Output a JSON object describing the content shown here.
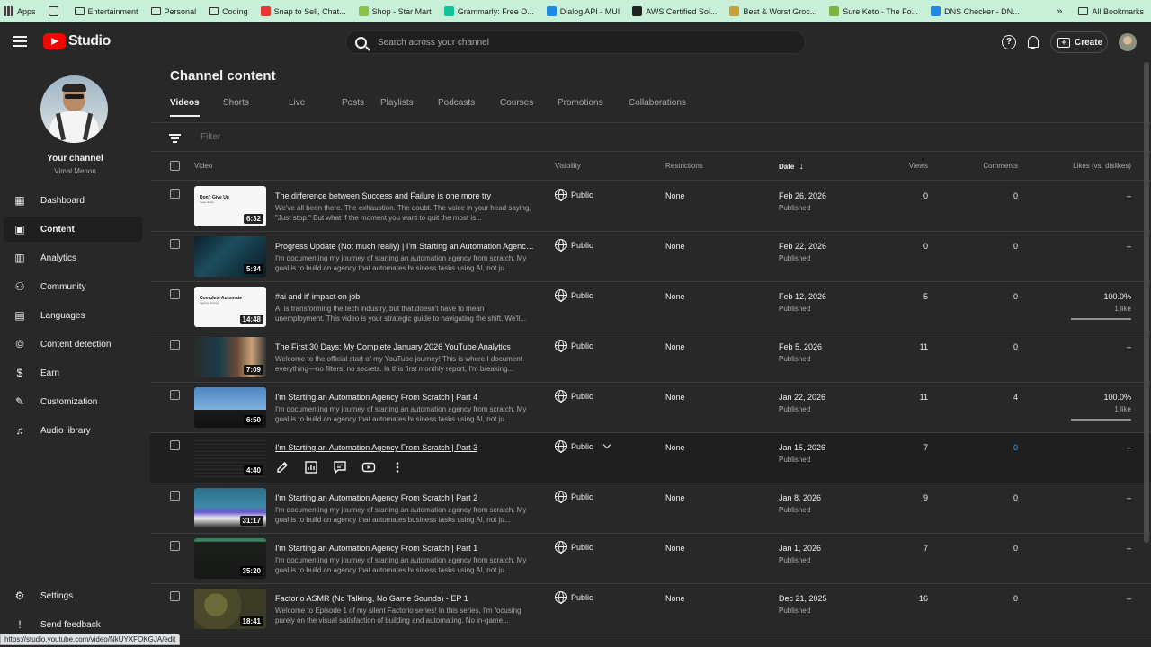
{
  "bookmarks": {
    "apps": "Apps",
    "items": [
      {
        "label": "Entertainment",
        "type": "folder"
      },
      {
        "label": "Personal",
        "type": "folder"
      },
      {
        "label": "Coding",
        "type": "folder"
      },
      {
        "label": "Snap to Sell, Chat...",
        "type": "site",
        "color": "#e53935"
      },
      {
        "label": "Shop - Star Mart",
        "type": "site",
        "color": "#8bc34a"
      },
      {
        "label": "Grammarly: Free O...",
        "type": "site",
        "color": "#15c39a"
      },
      {
        "label": "Dialog API - MUI",
        "type": "site",
        "color": "#1e88e5"
      },
      {
        "label": "AWS Certified Sol...",
        "type": "site",
        "color": "#222222"
      },
      {
        "label": "Best & Worst Groc...",
        "type": "site",
        "color": "#c8a03a"
      },
      {
        "label": "Sure Keto - The Fo...",
        "type": "site",
        "color": "#7cb342"
      },
      {
        "label": "DNS Checker - DN...",
        "type": "site",
        "color": "#1e88e5"
      }
    ],
    "overflow": "»",
    "all_bookmarks": "All Bookmarks"
  },
  "header": {
    "logo_text": "Studio",
    "search_placeholder": "Search across your channel",
    "help_glyph": "?",
    "create_label": "Create",
    "create_glyph": "+"
  },
  "sidebar": {
    "channel_label": "Your channel",
    "channel_name": "Vimal Menon",
    "items": [
      {
        "label": "Dashboard",
        "icon": "dashboard-icon",
        "glyph": "▦"
      },
      {
        "label": "Content",
        "icon": "content-icon",
        "glyph": "▣",
        "active": true
      },
      {
        "label": "Analytics",
        "icon": "analytics-icon",
        "glyph": "▥"
      },
      {
        "label": "Community",
        "icon": "community-icon",
        "glyph": "⚇"
      },
      {
        "label": "Languages",
        "icon": "languages-icon",
        "glyph": "▤"
      },
      {
        "label": "Content detection",
        "icon": "content-detection-icon",
        "glyph": "©"
      },
      {
        "label": "Earn",
        "icon": "earn-icon",
        "glyph": "$"
      },
      {
        "label": "Customization",
        "icon": "customization-icon",
        "glyph": "✎"
      },
      {
        "label": "Audio library",
        "icon": "audio-library-icon",
        "glyph": "♫"
      }
    ],
    "bottom_items": [
      {
        "label": "Settings",
        "icon": "settings-icon",
        "glyph": "⚙"
      },
      {
        "label": "Send feedback",
        "icon": "feedback-icon",
        "glyph": "!"
      }
    ]
  },
  "content": {
    "page_title": "Channel content",
    "tabs": [
      "Videos",
      "Shorts",
      "Live",
      "Posts",
      "Playlists",
      "Podcasts",
      "Courses",
      "Promotions",
      "Collaborations"
    ],
    "active_tab": "Videos",
    "filter_placeholder": "Filter",
    "columns": {
      "video": "Video",
      "visibility": "Visibility",
      "restrictions": "Restrictions",
      "date": "Date",
      "date_sort_glyph": "↓",
      "views": "Views",
      "comments": "Comments",
      "likes": "Likes (vs. dislikes)"
    },
    "rows": [
      {
        "title": "The difference between Success and Failure is one more try",
        "desc": "We've all been there. The exhaustion. The doubt. The voice in your head saying, \"Just stop.\" But what if the moment you want to quit the most is...",
        "duration": "6:32",
        "visibility": "Public",
        "restrictions": "None",
        "date": "Feb 26, 2026",
        "status": "Published",
        "views": "0",
        "comments": "0",
        "likes": "–",
        "likes_sub": "",
        "likes_fraction": 0,
        "thumb": "white",
        "thumb_title": "Don't Give Up",
        "thumb_sub": "Keep Going"
      },
      {
        "title": "Progress Update (Not much really) | I'm Starting an Automation Agency From Scratch",
        "desc": "I'm documenting my journey of starting an automation agency from scratch. My goal is to build an agency that automates business tasks using AI, not ju...",
        "duration": "5:34",
        "visibility": "Public",
        "restrictions": "None",
        "date": "Feb 22, 2026",
        "status": "Published",
        "views": "0",
        "comments": "0",
        "likes": "–",
        "likes_sub": "",
        "likes_fraction": 0,
        "thumb": "robot",
        "thumb_title": "",
        "thumb_sub": ""
      },
      {
        "title": "#ai and it' impact on job",
        "desc": "AI is transforming the tech industry, but that doesn't have to mean unemployment. This video is your strategic guide to navigating the shift. We'll...",
        "duration": "14:48",
        "visibility": "Public",
        "restrictions": "None",
        "date": "Feb 12, 2026",
        "status": "Published",
        "views": "5",
        "comments": "0",
        "likes": "100.0%",
        "likes_sub": "1 like",
        "likes_fraction": 1,
        "thumb": "white",
        "thumb_title": "Complete Automate",
        "thumb_sub": "Agency Journey"
      },
      {
        "title": "The First 30 Days: My Complete January 2026 YouTube Analytics",
        "desc": "Welcome to the official start of my YouTube journey! This is where I document everything—no filters, no secrets. In this first monthly report, I'm breaking...",
        "duration": "7:09",
        "visibility": "Public",
        "restrictions": "None",
        "date": "Feb 5, 2026",
        "status": "Published",
        "views": "11",
        "comments": "0",
        "likes": "–",
        "likes_sub": "",
        "likes_fraction": 0,
        "thumb": "person",
        "thumb_title": "",
        "thumb_sub": ""
      },
      {
        "title": "I'm Starting an Automation Agency From Scratch | Part 4",
        "desc": "I'm documenting my journey of starting an automation agency from scratch. My goal is to build an agency that automates business tasks using AI, not ju...",
        "duration": "6:50",
        "visibility": "Public",
        "restrictions": "None",
        "date": "Jan 22, 2026",
        "status": "Published",
        "views": "11",
        "comments": "4",
        "likes": "100.0%",
        "likes_sub": "1 like",
        "likes_fraction": 1,
        "thumb": "sky",
        "thumb_title": "",
        "thumb_sub": ""
      },
      {
        "title": "I'm Starting an Automation Agency From Scratch | Part 3",
        "desc": "",
        "duration": "4:40",
        "visibility": "Public",
        "restrictions": "None",
        "date": "Jan 15, 2026",
        "status": "Published",
        "views": "7",
        "comments": "0",
        "likes": "–",
        "likes_sub": "",
        "likes_fraction": 0,
        "thumb": "code",
        "thumb_title": "",
        "thumb_sub": "",
        "hover": true
      },
      {
        "title": "I'm Starting an Automation Agency From Scratch | Part 2",
        "desc": "I'm documenting my journey of starting an automation agency from scratch. My goal is to build an agency that automates business tasks using AI, not ju...",
        "duration": "31:17",
        "visibility": "Public",
        "restrictions": "None",
        "date": "Jan 8, 2026",
        "status": "Published",
        "views": "9",
        "comments": "0",
        "likes": "–",
        "likes_sub": "",
        "likes_fraction": 0,
        "thumb": "screen",
        "thumb_title": "",
        "thumb_sub": ""
      },
      {
        "title": "I'm Starting an Automation Agency From Scratch | Part 1",
        "desc": "I'm documenting my journey of starting an automation agency from scratch. My goal is to build an agency that automates business tasks using AI, not ju...",
        "duration": "35:20",
        "visibility": "Public",
        "restrictions": "None",
        "date": "Jan 1, 2026",
        "status": "Published",
        "views": "7",
        "comments": "0",
        "likes": "–",
        "likes_sub": "",
        "likes_fraction": 0,
        "thumb": "dark",
        "thumb_title": "",
        "thumb_sub": ""
      },
      {
        "title": "Factorio ASMR (No Talking, No Game Sounds) - EP 1",
        "desc": "Welcome to Episode 1 of my silent Factorio series! In this series, I'm focusing purely on the visual satisfaction of building and automating. No in-game...",
        "duration": "18:41",
        "visibility": "Public",
        "restrictions": "None",
        "date": "Dec 21, 2025",
        "status": "Published",
        "views": "16",
        "comments": "0",
        "likes": "–",
        "likes_sub": "",
        "likes_fraction": 0,
        "thumb": "game",
        "thumb_title": "",
        "thumb_sub": ""
      }
    ],
    "hover_actions": [
      "edit-icon",
      "analytics-icon",
      "comments-icon",
      "youtube-icon",
      "more-icon"
    ]
  },
  "status_url": "https://studio.youtube.com/video/NkUYXFOKGJA/edit"
}
